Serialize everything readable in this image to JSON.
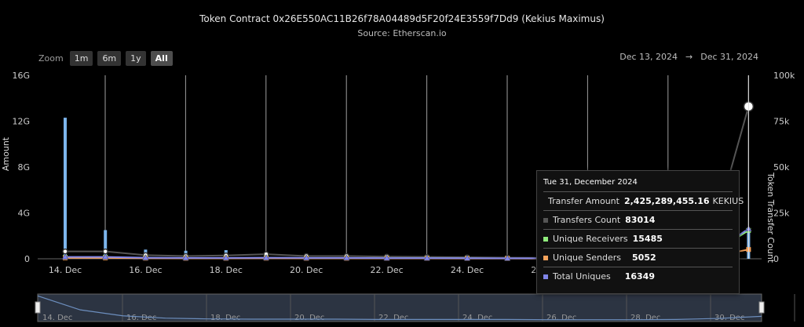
{
  "header": {
    "title": "Token Contract 0x26E550AC11B26f78A04489d5F20f24E3559f7Dd9 (Kekius Maximus)",
    "subtitle": "Source: Etherscan.io"
  },
  "zoom": {
    "label": "Zoom",
    "buttons": [
      "1m",
      "6m",
      "1y",
      "All"
    ],
    "active": "All"
  },
  "range": {
    "from": "Dec 13, 2024",
    "arrow": "→",
    "to": "Dec 31, 2024"
  },
  "tooltip": {
    "date": "Tue 31, December 2024",
    "rows": [
      {
        "label": "Transfer Amount",
        "value": "2,425,289,455.16",
        "unit": "KEKIUS",
        "color": "#7cb5ec"
      },
      {
        "label": "Transfers Count",
        "value": "83014",
        "unit": "",
        "color": "#434348"
      },
      {
        "label": "Unique Receivers",
        "value": "15485",
        "unit": "",
        "color": "#90ed7d"
      },
      {
        "label": "Unique Senders",
        "value": "5052",
        "unit": "",
        "color": "#f7a35c"
      },
      {
        "label": "Total Uniques",
        "value": "16349",
        "unit": "",
        "color": "#8085e9"
      }
    ]
  },
  "chart_data": {
    "type": "bar",
    "x": [
      "2024-12-14",
      "2024-12-15",
      "2024-12-16",
      "2024-12-17",
      "2024-12-18",
      "2024-12-19",
      "2024-12-20",
      "2024-12-21",
      "2024-12-22",
      "2024-12-23",
      "2024-12-24",
      "2024-12-25",
      "2024-12-26",
      "2024-12-27",
      "2024-12-28",
      "2024-12-29",
      "2024-12-30",
      "2024-12-31"
    ],
    "x_tick_labels": [
      "14. Dec",
      "16. Dec",
      "18. Dec",
      "20. Dec",
      "22. Dec",
      "24. Dec",
      "26. Dec",
      "28. Dec",
      "30. Dec"
    ],
    "navigator_labels": [
      "14. Dec",
      "16. Dec",
      "18. Dec",
      "20. Dec",
      "22. Dec",
      "24. Dec",
      "26. Dec",
      "28. Dec",
      "30. Dec"
    ],
    "y_left": {
      "label": "Amount",
      "ticks": [
        "0",
        "4G",
        "8G",
        "12G",
        "16G"
      ],
      "range": [
        0,
        16000000000
      ]
    },
    "y_right": {
      "label": "Token Transfer Count",
      "ticks": [
        "0",
        "25k",
        "50k",
        "75k",
        "100k"
      ],
      "range": [
        0,
        100000
      ]
    },
    "series": [
      {
        "name": "Transfer Amount",
        "type": "column",
        "axis": "left",
        "color": "#7cb5ec",
        "values": [
          12300000000,
          2500000000,
          800000000,
          700000000,
          750000000,
          300000000,
          200000000,
          200000000,
          150000000,
          150000000,
          120000000,
          100000000,
          90000000,
          80000000,
          70000000,
          60000000,
          80000000,
          2425289455
        ]
      },
      {
        "name": "Transfers Count",
        "type": "line",
        "axis": "right",
        "color": "#434348",
        "values": [
          4000,
          4000,
          2000,
          1500,
          1800,
          2500,
          1500,
          1500,
          1200,
          1000,
          800,
          600,
          500,
          500,
          600,
          800,
          5000,
          83014
        ]
      },
      {
        "name": "Unique Receivers",
        "type": "line",
        "axis": "right",
        "color": "#90ed7d",
        "values": [
          800,
          800,
          500,
          400,
          400,
          500,
          400,
          400,
          300,
          300,
          250,
          200,
          200,
          200,
          200,
          250,
          1500,
          15485
        ]
      },
      {
        "name": "Unique Senders",
        "type": "line",
        "axis": "right",
        "color": "#f7a35c",
        "values": [
          500,
          500,
          300,
          250,
          250,
          300,
          250,
          250,
          200,
          200,
          150,
          150,
          100,
          100,
          100,
          150,
          800,
          5052
        ]
      },
      {
        "name": "Total Uniques",
        "type": "line",
        "axis": "right",
        "color": "#8085e9",
        "values": [
          1000,
          1000,
          600,
          500,
          500,
          600,
          500,
          500,
          400,
          400,
          300,
          250,
          250,
          250,
          250,
          300,
          1800,
          16349
        ]
      }
    ],
    "navigator_series": [
      0.99,
      0.45,
      0.22,
      0.13,
      0.1,
      0.09,
      0.09,
      0.09,
      0.08,
      0.08,
      0.08,
      0.08,
      0.07,
      0.07,
      0.07,
      0.08,
      0.12,
      0.2
    ],
    "grid": "vertical",
    "legend": "tooltip"
  }
}
